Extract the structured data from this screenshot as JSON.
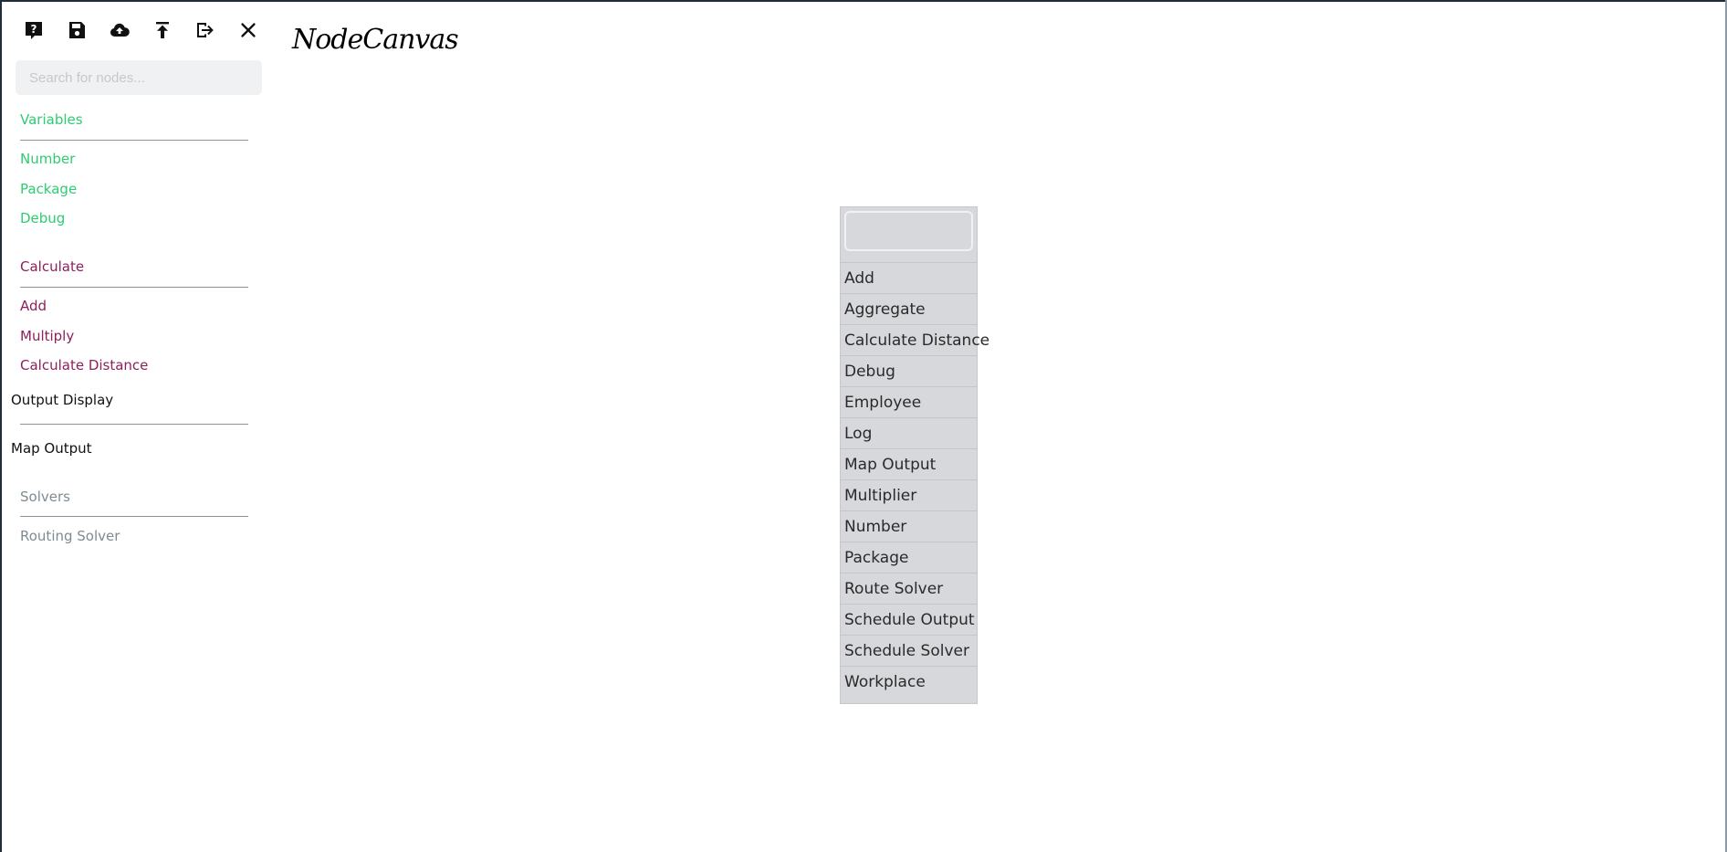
{
  "toolbar": {
    "buttons": [
      {
        "name": "help-icon"
      },
      {
        "name": "save-icon"
      },
      {
        "name": "cloud-upload-icon"
      },
      {
        "name": "upload-icon"
      },
      {
        "name": "exit-icon"
      },
      {
        "name": "close-icon"
      }
    ]
  },
  "search": {
    "placeholder": "Search for nodes..."
  },
  "sidebar": {
    "groups": [
      {
        "title": "Variables",
        "color": "#2ecc71",
        "items": [
          "Number",
          "Package",
          "Debug"
        ]
      },
      {
        "title": "Calculate",
        "color": "#8e1f5c",
        "items": [
          "Add",
          "Multiply",
          "Calculate Distance"
        ]
      },
      {
        "title": "Output Display",
        "color": "#111111",
        "items": [
          "Map Output"
        ]
      },
      {
        "title": "Solvers",
        "color": "#7f8b93",
        "items": [
          "Routing Solver"
        ]
      }
    ]
  },
  "logo": {
    "text": "NodeCanvas"
  },
  "nodelist": {
    "items": [
      "Add",
      "Aggregate",
      "Calculate Distance",
      "Debug",
      "Employee",
      "Log",
      "Map Output",
      "Multiplier",
      "Number",
      "Package",
      "Route Solver",
      "Schedule Output",
      "Schedule Solver",
      "Workplace"
    ]
  }
}
